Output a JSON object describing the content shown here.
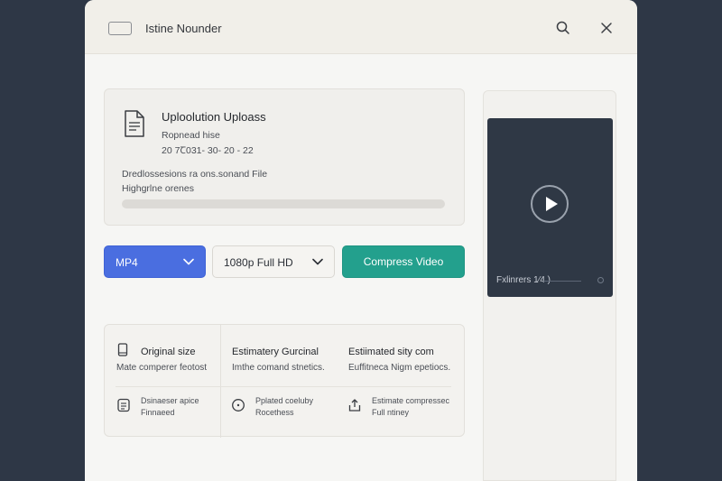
{
  "window": {
    "title": "Istine Nounder"
  },
  "upload": {
    "title": "Uploolution Uploass",
    "sub1": "Ropnead hise",
    "sub2": "20 7Ꞇ031- 30- 20 - 22",
    "desc1": "Dredlossesions ra ons.sonand File",
    "desc2": "Highgrlne orenes",
    "progress_fraction": 0.0
  },
  "controls": {
    "format": "MP4",
    "resolution": "1080p Full HD",
    "compress_label": "Compress Video"
  },
  "stats": {
    "columns": [
      {
        "head": "Original size",
        "sub": "Mate comperer feotost",
        "icon": "phone-icon"
      },
      {
        "head": "Estimatery Gurcinal",
        "sub": "Imthe comand stnetics.",
        "icon": ""
      },
      {
        "head": "Estiimated sity com",
        "sub": "Euffitneca Nigm epetiocs.",
        "icon": ""
      }
    ],
    "details": [
      {
        "line1": "Dsinaeser apice",
        "line2": "Finnaeed",
        "icon": "document-list-icon"
      },
      {
        "line1": "Pplated coeluby",
        "line2": "Rocethess",
        "icon": "clock-icon"
      },
      {
        "line1": "Estimate compressec",
        "line2": "Full ntiney",
        "icon": "upload-icon"
      }
    ]
  },
  "preview": {
    "label": "Fxlinrers 1⁄4 )",
    "play_icon": "play-icon"
  },
  "colors": {
    "accent_blue": "#4a6ee0",
    "accent_teal": "#23a08d",
    "background": "#2e3746"
  }
}
